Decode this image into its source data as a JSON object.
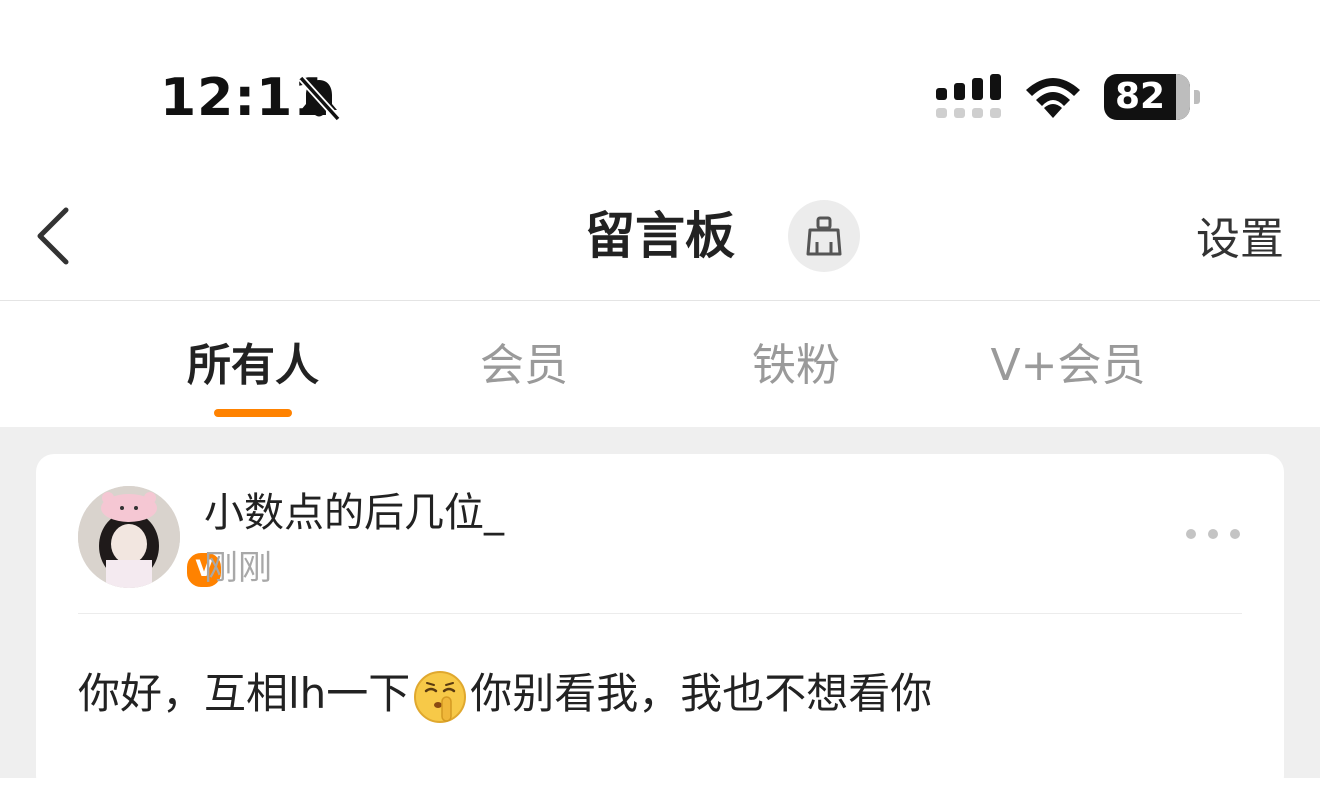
{
  "status_bar": {
    "time": "12:11",
    "battery_level": "82",
    "icons": [
      "bell-slash-icon",
      "cellular-signal-icon",
      "wifi-icon",
      "battery-icon"
    ]
  },
  "nav": {
    "title": "留言板",
    "back_icon": "chevron-left-icon",
    "clean_icon": "broom-icon",
    "settings_label": "设置"
  },
  "tabs": [
    {
      "label": "所有人",
      "active": true
    },
    {
      "label": "会员",
      "active": false
    },
    {
      "label": "铁粉",
      "active": false
    },
    {
      "label": "V+会员",
      "active": false
    }
  ],
  "post": {
    "username": "小数点的后几位_",
    "time": "刚刚",
    "verified_badge": "V",
    "message_part1": "你好，互相lh一下",
    "emoji": "shushing-face-emoji",
    "message_part2": "你别看我，我也不想看你"
  },
  "colors": {
    "accent": "#ff8200",
    "background": "#efefef",
    "card": "#ffffff",
    "inactive_tab": "#9a9a9a"
  }
}
